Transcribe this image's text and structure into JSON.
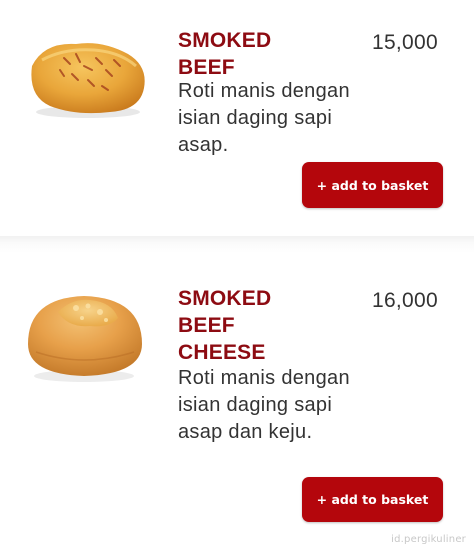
{
  "products": [
    {
      "name_lines": [
        "SMOKED",
        "BEEF"
      ],
      "description": "Roti manis dengan isian daging sapi asap.",
      "price": "15,000",
      "add_label": "+ add to basket",
      "image_icon": "smoked-beef-bread-icon"
    },
    {
      "name_lines": [
        "SMOKED",
        "BEEF",
        "CHEESE"
      ],
      "description": "Roti manis dengan isian daging sapi asap dan keju.",
      "price": "16,000",
      "add_label": "+ add to basket",
      "image_icon": "smoked-beef-cheese-bun-icon"
    }
  ],
  "watermark": "id.pergikuliner",
  "colors": {
    "name": "#8d0b12",
    "button": "#b4060c",
    "text": "#333333"
  }
}
